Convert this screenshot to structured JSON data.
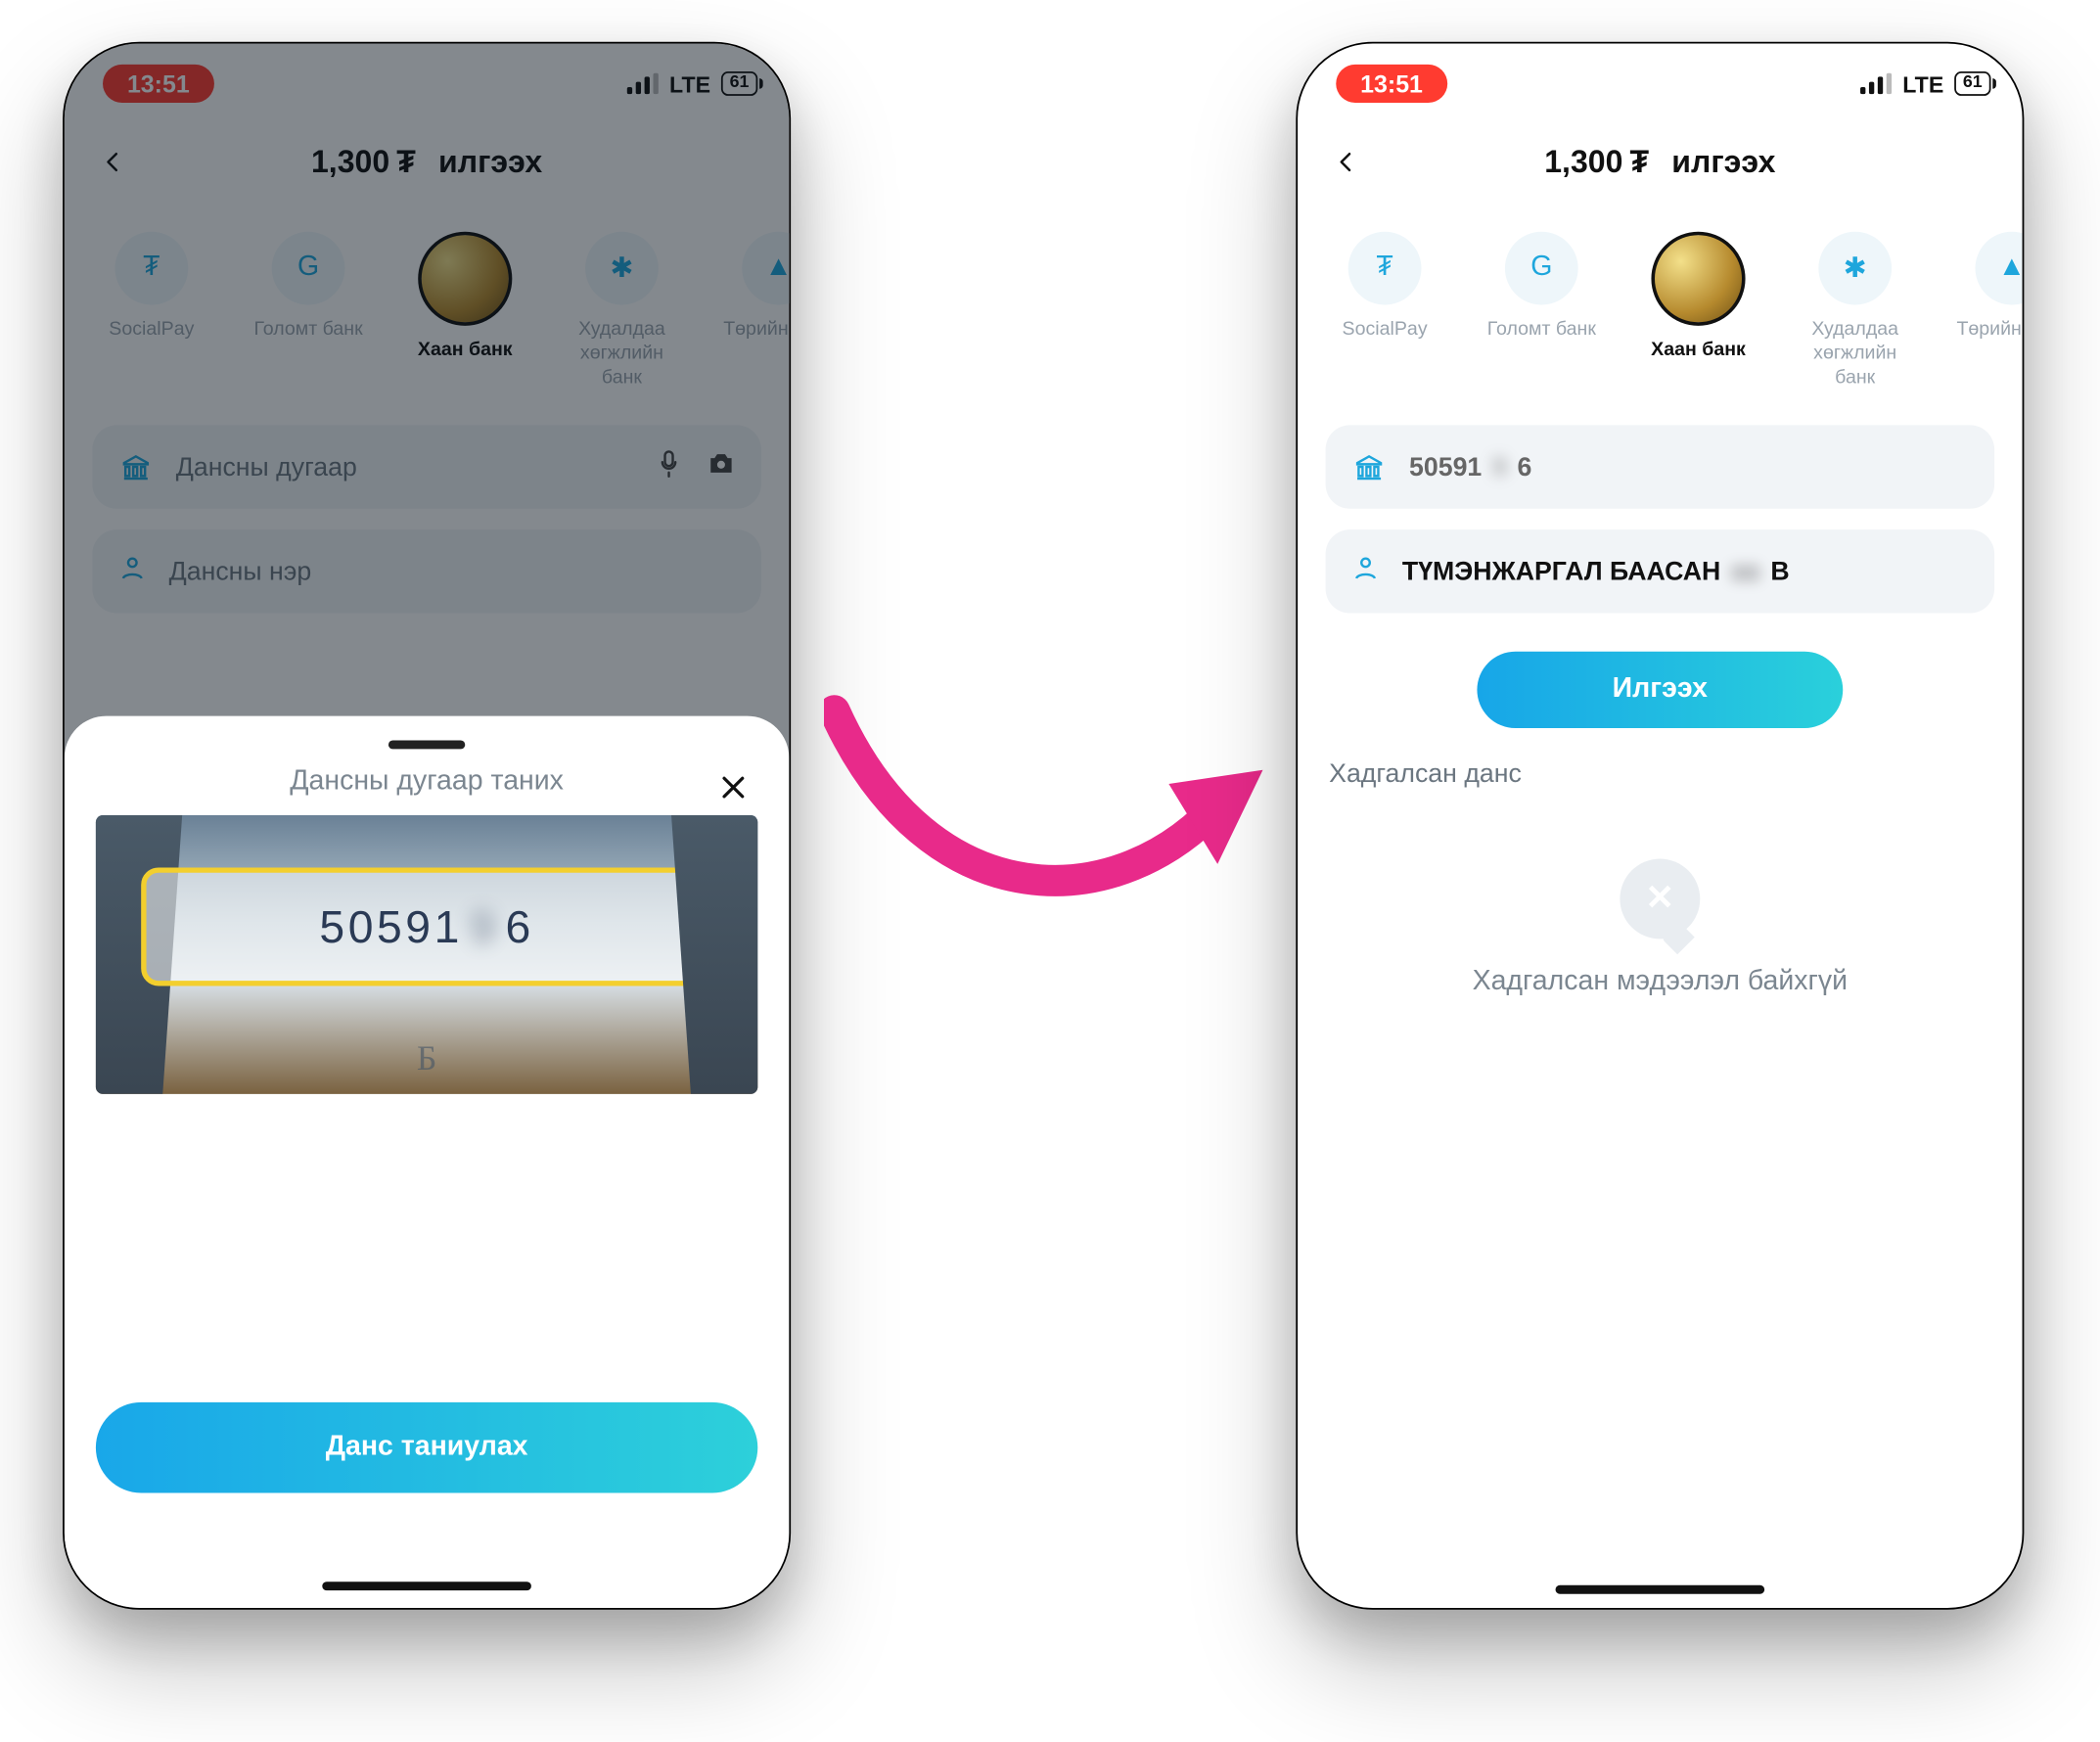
{
  "status": {
    "time": "13:51",
    "network": "LTE",
    "battery": "61"
  },
  "header": {
    "amount": "1,300",
    "currency": "₮",
    "action": "илгээх"
  },
  "banks": [
    {
      "label": "SocialPay"
    },
    {
      "label": "Голомт банк"
    },
    {
      "label": "Хаан банк",
      "active": true
    },
    {
      "label": "Худалдаа хөгжлийн банк"
    },
    {
      "label": "Төрийн банк"
    }
  ],
  "leftScreen": {
    "accountPlaceholder": "Дансны дугаар",
    "namePlaceholder": "Дансны нэр",
    "sheetTitle": "Дансны дугаар таних",
    "detectedPrefix": "50591",
    "detectedHidden": "9",
    "detectedSuffix": "6",
    "scribble": "Б",
    "cta": "Данс таниулах"
  },
  "rightScreen": {
    "accountPrefix": "50591",
    "accountHidden": "9",
    "accountSuffix": "6",
    "holderPrefix": "ТҮМЭНЖАРГАЛ БААСАН",
    "holderSuffix": "В",
    "sendLabel": "Илгээх",
    "savedLabel": "Хадгалсан данс",
    "emptyLabel": "Хадгалсан мэдээлэл байхгүй"
  }
}
